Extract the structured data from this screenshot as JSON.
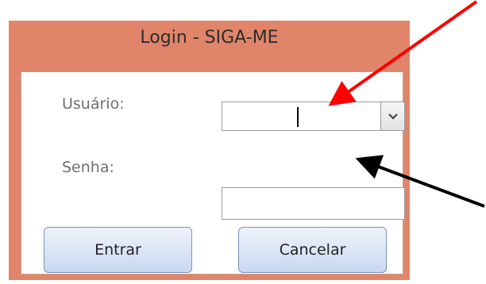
{
  "dialog": {
    "title": "Login - SIGA-ME",
    "background_color": "#e0856a"
  },
  "form": {
    "user_label": "Usuário:",
    "user_value": "",
    "password_label": "Senha:",
    "password_value": ""
  },
  "buttons": {
    "enter_label": "Entrar",
    "cancel_label": "Cancelar"
  },
  "annotations": {
    "arrow_user_color": "#ff0000",
    "arrow_password_color": "#000000"
  },
  "icons": {
    "dropdown": "chevron-down-icon"
  }
}
